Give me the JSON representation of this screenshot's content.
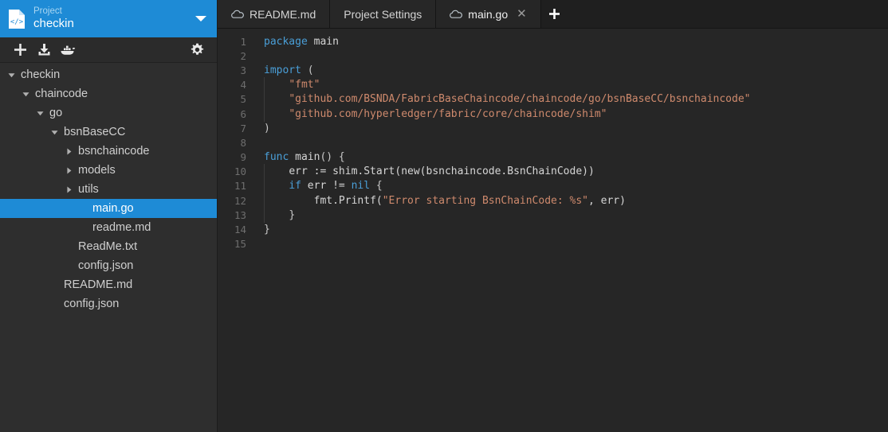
{
  "sidebar": {
    "project": {
      "label": "Project",
      "name": "checkin",
      "icon": "code-file-icon",
      "caret": "chevron-down-icon",
      "accent_color": "#1e8bd6"
    },
    "toolbar": {
      "buttons": [
        {
          "name": "add-icon",
          "title": "Add"
        },
        {
          "name": "import-icon",
          "title": "Import"
        },
        {
          "name": "docker-whale-icon",
          "title": "Docker"
        }
      ],
      "settings": {
        "name": "gear-icon",
        "title": "Settings"
      }
    },
    "tree": [
      {
        "label": "checkin",
        "depth": 0,
        "state": "expanded",
        "type": "folder",
        "selected": false
      },
      {
        "label": "chaincode",
        "depth": 1,
        "state": "expanded",
        "type": "folder",
        "selected": false
      },
      {
        "label": "go",
        "depth": 2,
        "state": "expanded",
        "type": "folder",
        "selected": false
      },
      {
        "label": "bsnBaseCC",
        "depth": 3,
        "state": "expanded",
        "type": "folder",
        "selected": false
      },
      {
        "label": "bsnchaincode",
        "depth": 4,
        "state": "collapsed",
        "type": "folder",
        "selected": false
      },
      {
        "label": "models",
        "depth": 4,
        "state": "collapsed",
        "type": "folder",
        "selected": false
      },
      {
        "label": "utils",
        "depth": 4,
        "state": "collapsed",
        "type": "folder",
        "selected": false
      },
      {
        "label": "main.go",
        "depth": 5,
        "state": "leaf",
        "type": "file",
        "selected": true
      },
      {
        "label": "readme.md",
        "depth": 5,
        "state": "leaf",
        "type": "file",
        "selected": false
      },
      {
        "label": "ReadMe.txt",
        "depth": 4,
        "state": "leaf",
        "type": "file",
        "selected": false
      },
      {
        "label": "config.json",
        "depth": 4,
        "state": "leaf",
        "type": "file",
        "selected": false
      },
      {
        "label": "README.md",
        "depth": 3,
        "state": "leaf",
        "type": "file",
        "selected": false
      },
      {
        "label": "config.json",
        "depth": 3,
        "state": "leaf",
        "type": "file",
        "selected": false
      }
    ]
  },
  "editor": {
    "tabs": [
      {
        "label": "README.md",
        "icon": "cloud-icon",
        "active": false,
        "closable": false
      },
      {
        "label": "Project Settings",
        "icon": null,
        "active": false,
        "closable": false
      },
      {
        "label": "main.go",
        "icon": "cloud-icon",
        "active": true,
        "closable": true,
        "close_glyph": "✕"
      }
    ],
    "add_tab": {
      "name": "new-tab-button",
      "glyph": "+"
    },
    "code": {
      "language": "go",
      "line_numbers": [
        "1",
        "2",
        "3",
        "4",
        "5",
        "6",
        "7",
        "8",
        "9",
        "10",
        "11",
        "12",
        "13",
        "14",
        "15"
      ],
      "lines": [
        {
          "n": "1",
          "indent": 0,
          "guide": false,
          "tokens": [
            {
              "t": "package ",
              "c": "kw"
            },
            {
              "t": "main",
              "c": "id"
            }
          ]
        },
        {
          "n": "2",
          "indent": 0,
          "guide": false,
          "tokens": []
        },
        {
          "n": "3",
          "indent": 0,
          "guide": false,
          "tokens": [
            {
              "t": "import ",
              "c": "kw"
            },
            {
              "t": "(",
              "c": "pl"
            }
          ]
        },
        {
          "n": "4",
          "indent": 1,
          "guide": true,
          "tokens": [
            {
              "t": "\"fmt\"",
              "c": "str"
            }
          ]
        },
        {
          "n": "5",
          "indent": 1,
          "guide": true,
          "tokens": [
            {
              "t": "\"github.com/BSNDA/FabricBaseChaincode/chaincode/go/bsnBaseCC/bsnchaincode\"",
              "c": "str"
            }
          ]
        },
        {
          "n": "6",
          "indent": 1,
          "guide": true,
          "tokens": [
            {
              "t": "\"github.com/hyperledger/fabric/core/chaincode/shim\"",
              "c": "str"
            }
          ]
        },
        {
          "n": "7",
          "indent": 0,
          "guide": false,
          "tokens": [
            {
              "t": ")",
              "c": "pl"
            }
          ]
        },
        {
          "n": "8",
          "indent": 0,
          "guide": false,
          "tokens": []
        },
        {
          "n": "9",
          "indent": 0,
          "guide": false,
          "tokens": [
            {
              "t": "func ",
              "c": "kw"
            },
            {
              "t": "main",
              "c": "id"
            },
            {
              "t": "() {",
              "c": "pl"
            }
          ]
        },
        {
          "n": "10",
          "indent": 1,
          "guide": true,
          "tokens": [
            {
              "t": "err := shim.Start(new(bsnchaincode.BsnChainCode))",
              "c": "id"
            }
          ]
        },
        {
          "n": "11",
          "indent": 1,
          "guide": true,
          "tokens": [
            {
              "t": "if ",
              "c": "kw"
            },
            {
              "t": "err != ",
              "c": "id"
            },
            {
              "t": "nil",
              "c": "kw"
            },
            {
              "t": " {",
              "c": "pl"
            }
          ]
        },
        {
          "n": "12",
          "indent": 2,
          "guide": true,
          "tokens": [
            {
              "t": "fmt.Printf(",
              "c": "id"
            },
            {
              "t": "\"Error starting BsnChainCode: %s\"",
              "c": "str"
            },
            {
              "t": ", err)",
              "c": "id"
            }
          ]
        },
        {
          "n": "13",
          "indent": 1,
          "guide": true,
          "tokens": [
            {
              "t": "}",
              "c": "pl"
            }
          ]
        },
        {
          "n": "14",
          "indent": 0,
          "guide": false,
          "tokens": [
            {
              "t": "}",
              "c": "pl"
            }
          ]
        },
        {
          "n": "15",
          "indent": 0,
          "guide": false,
          "tokens": []
        }
      ]
    }
  },
  "colors": {
    "sidebar_bg": "#2e2e2e",
    "editor_bg": "#262626",
    "tabbar_bg": "#1f1f1f",
    "accent": "#1e8bd6",
    "keyword": "#4a9fd8",
    "string": "#cf8a6d",
    "identifier": "#d6d6d6",
    "line_number": "#6e6e6e"
  }
}
